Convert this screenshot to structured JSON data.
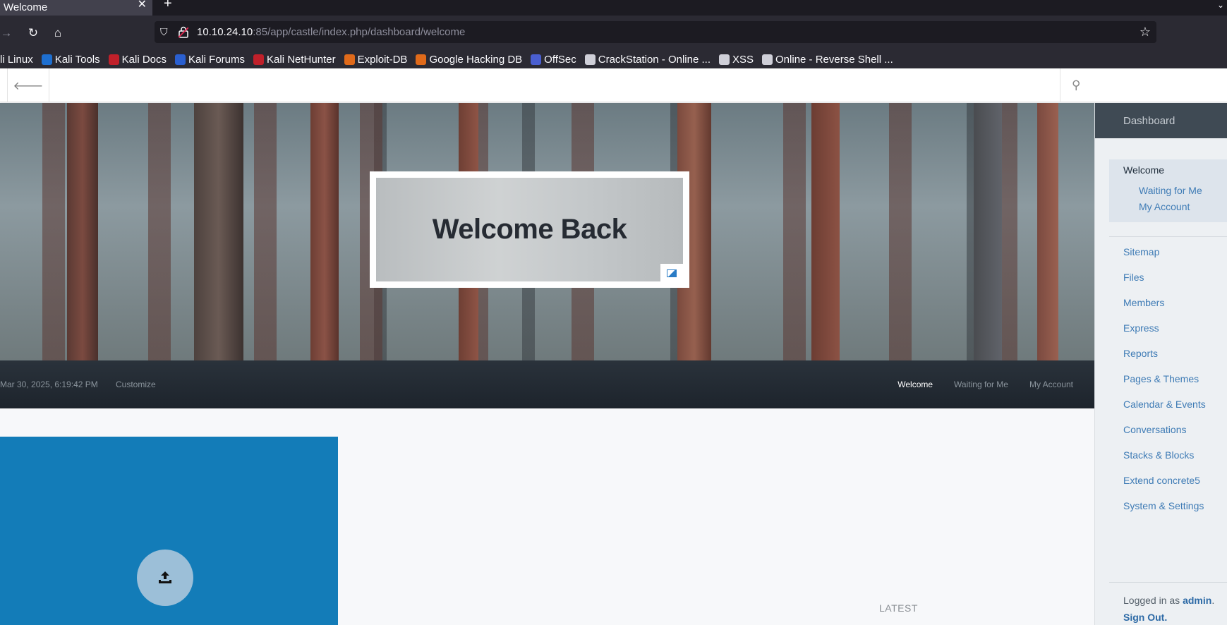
{
  "browser": {
    "tab_title": "Welcome",
    "tab_close": "✕",
    "new_tab": "+",
    "url_host": "10.10.24.10",
    "url_rest": ":85/app/castle/index.php/dashboard/welcome",
    "bookmarks": [
      {
        "label": "li Linux",
        "color": "#1e6fd0"
      },
      {
        "label": "Kali Tools",
        "color": "#1e6fd0"
      },
      {
        "label": "Kali Docs",
        "color": "#c0202a"
      },
      {
        "label": "Kali Forums",
        "color": "#2a5fd0"
      },
      {
        "label": "Kali NetHunter",
        "color": "#c0202a"
      },
      {
        "label": "Exploit-DB",
        "color": "#e06a1a"
      },
      {
        "label": "Google Hacking DB",
        "color": "#e06a1a"
      },
      {
        "label": "OffSec",
        "color": "#4a5fd0"
      },
      {
        "label": "CrackStation - Online ...",
        "color": "#cfcfd8"
      },
      {
        "label": "XSS",
        "color": "#cfcfd8"
      },
      {
        "label": "Online - Reverse Shell ...",
        "color": "#cfcfd8"
      }
    ]
  },
  "hero": {
    "title": "Welcome Back"
  },
  "subnav": {
    "date": "Mar 30, 2025, 6:19:42 PM",
    "customize": "Customize",
    "links": [
      "Welcome",
      "Waiting for Me",
      "My Account"
    ]
  },
  "content": {
    "latest": "LATEST"
  },
  "dashboard": {
    "header": "Dashboard",
    "current_group": [
      "Welcome",
      "Waiting for Me",
      "My Account"
    ],
    "items": [
      "Sitemap",
      "Files",
      "Members",
      "Express",
      "Reports",
      "Pages & Themes",
      "Calendar & Events",
      "Conversations",
      "Stacks & Blocks",
      "Extend concrete5",
      "System & Settings"
    ],
    "logged_prefix": "Logged in as",
    "user": "admin",
    "logged_suffix": ".",
    "sign_out": "Sign Out."
  }
}
